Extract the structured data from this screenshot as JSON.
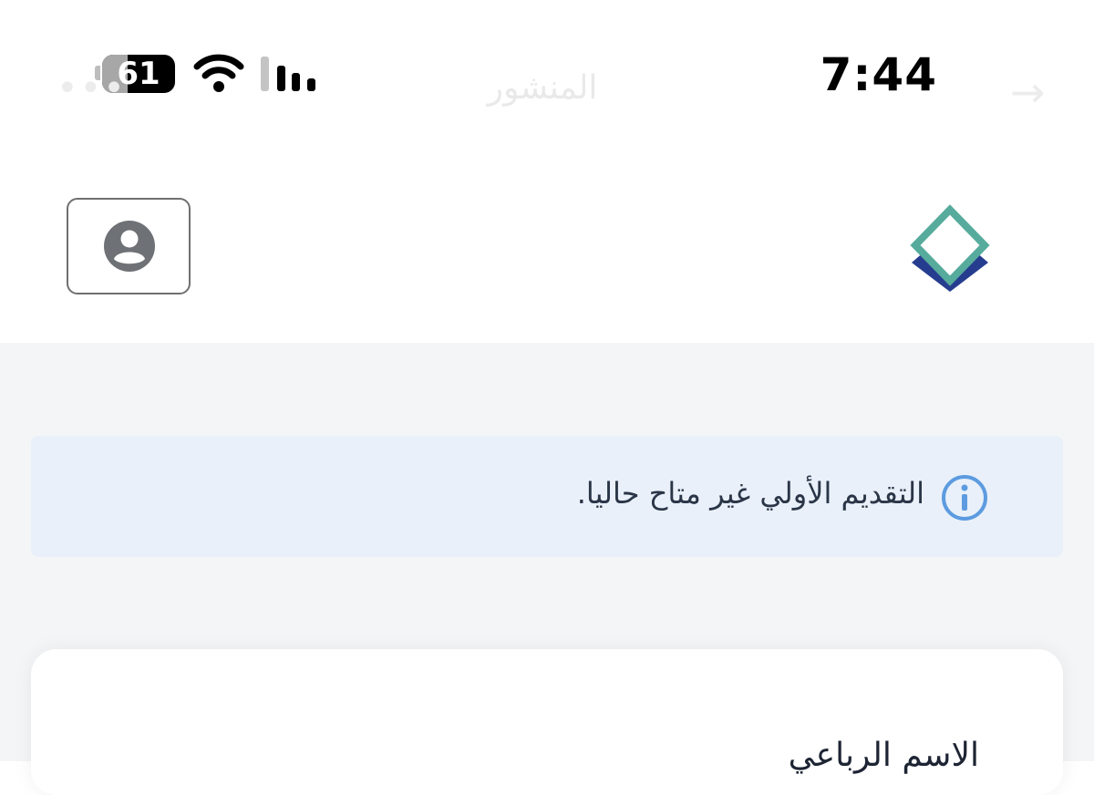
{
  "status_bar": {
    "time": "7:44",
    "battery_level": "61",
    "icons": [
      "wifi-icon",
      "cellular-signal-icon",
      "battery-icon"
    ]
  },
  "background_nav": {
    "title": "المنشور",
    "icons": [
      "back-arrow-icon",
      "more-dots-icon"
    ]
  },
  "header": {
    "profile_icon": "account-circle-icon",
    "logo_icon": "diamond-logo-icon"
  },
  "info_banner": {
    "message": "التقديم الأولي غير متاح حاليا.",
    "icon": "info-icon"
  },
  "form": {
    "first_field_label": "الاسم الرباعي"
  },
  "colors": {
    "logo_teal": "#56ab9c",
    "logo_navy": "#263d8f",
    "info_blue": "#5c9be0",
    "banner_bg": "#e9f0f9",
    "page_bg": "#f4f5f7",
    "profile_gray": "#6e7175"
  }
}
